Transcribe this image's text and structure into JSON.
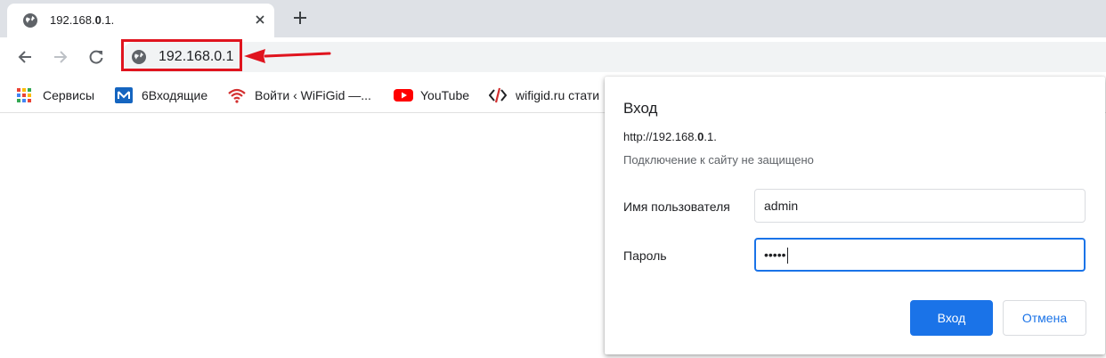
{
  "tab": {
    "title_pre": "192.168.",
    "title_bold": "0",
    "title_post": ".1."
  },
  "omnibox": {
    "url": "192.168.0.1"
  },
  "bookmarks": [
    {
      "label": "Сервисы",
      "icon": "apps-grid-icon"
    },
    {
      "label": "6Входящие",
      "icon": "mail-icon"
    },
    {
      "label": "Войти ‹ WiFiGid —...",
      "icon": "wifi-icon"
    },
    {
      "label": "YouTube",
      "icon": "youtube-icon"
    },
    {
      "label": "wifigid.ru  стати",
      "icon": "wifigid-icon"
    }
  ],
  "dialog": {
    "title": "Вход",
    "url_pre": "http://192.168.",
    "url_bold": "0",
    "url_post": ".1.",
    "warning": "Подключение к сайту не защищено",
    "username_label": "Имя пользователя",
    "username_value": "admin",
    "password_label": "Пароль",
    "password_value": "•••••",
    "login_button": "Вход",
    "cancel_button": "Отмена"
  },
  "colors": {
    "accent": "#1a73e8",
    "highlight": "#e0141e"
  }
}
